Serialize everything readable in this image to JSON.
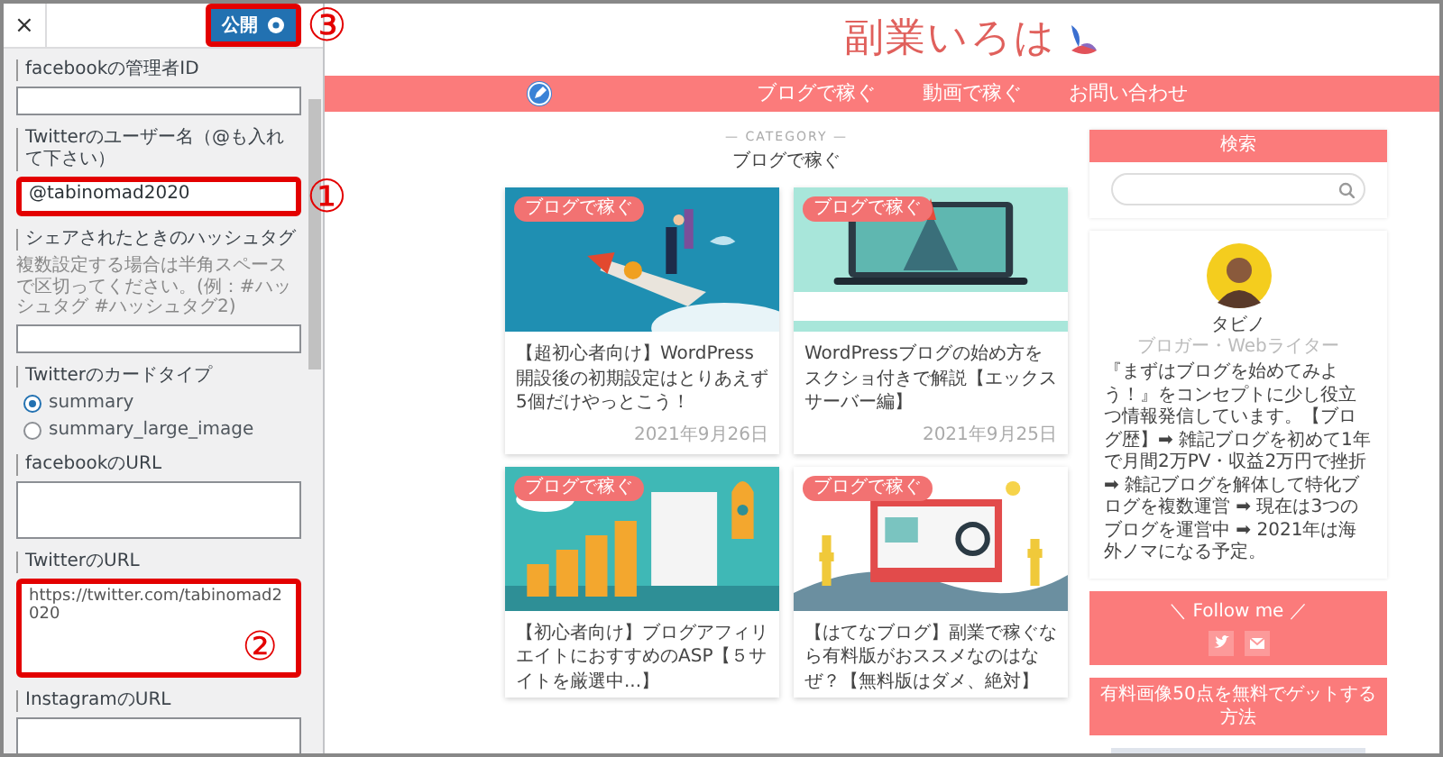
{
  "customizer": {
    "close": "×",
    "publish": {
      "label": "公開",
      "highlighted": true,
      "callout": "③"
    },
    "fields": [
      {
        "kind": "input",
        "label": "facebookの管理者ID",
        "highlighted": false
      },
      {
        "kind": "input",
        "label": "Twitterのユーザー名（@も入れて下さい）",
        "value": "@tabinomad2020",
        "highlighted": true,
        "callout": "①"
      },
      {
        "kind": "input",
        "label": "シェアされたときのハッシュタグ",
        "description": "複数設定する場合は半角スペースで区切ってください。(例：#ハッシュタグ #ハッシュタグ2)",
        "highlighted": false
      },
      {
        "kind": "radio",
        "label": "Twitterのカードタイプ",
        "options": [
          {
            "label": "summary",
            "selected": true
          },
          {
            "label": "summary_large_image",
            "selected": false
          }
        ]
      },
      {
        "kind": "textarea",
        "label": "facebookのURL",
        "highlighted": false
      },
      {
        "kind": "textarea",
        "label": "TwitterのURL",
        "value": "https://twitter.com/tabinomad2020",
        "highlighted": true,
        "callout": "②"
      },
      {
        "kind": "textarea",
        "label": "InstagramのURL",
        "highlighted": false
      }
    ]
  },
  "site": {
    "logo": "副業いろは",
    "nav": [
      "ブログで稼ぐ",
      "動画で稼ぐ",
      "お問い合わせ"
    ],
    "category_label": "— CATEGORY —",
    "category": "ブログで稼ぐ",
    "posts": [
      {
        "tag": "ブログで稼ぐ",
        "title": "【超初心者向け】WordPress開設後の初期設定はとりあえず5個だけやっとこう！",
        "date": "2021年9月26日"
      },
      {
        "tag": "ブログで稼ぐ",
        "title": "WordPressブログの始め方をスクショ付きで解説【エックスサーバー編】",
        "date": "2021年9月25日"
      },
      {
        "tag": "ブログで稼ぐ",
        "title": "【初心者向け】ブログアフィリエイトにおすすめのASP【５サイトを厳選中...】"
      },
      {
        "tag": "ブログで稼ぐ",
        "title": "【はてなブログ】副業で稼ぐなら有料版がおススメなのはなぜ？【無料版はダメ、絶対】"
      }
    ],
    "sidebar": {
      "search_title": "検索",
      "profile": {
        "name": "タビノ",
        "role": "ブロガー・Webライター",
        "bio": "『まずはブログを始めてみよう！』をコンセプトに少し役立つ情報発信しています。【ブログ歴】➡ 雑記ブログを初めて1年で月間2万PV・収益2万円で挫折 ➡ 雑記ブログを解体して特化ブログを複数運営 ➡ 現在は3つのブログを運営中 ➡ 2021年は海外ノマになる予定。"
      },
      "follow_title": "＼ Follow me ／",
      "promo": "有料画像50点を無料でゲットする方法"
    }
  }
}
